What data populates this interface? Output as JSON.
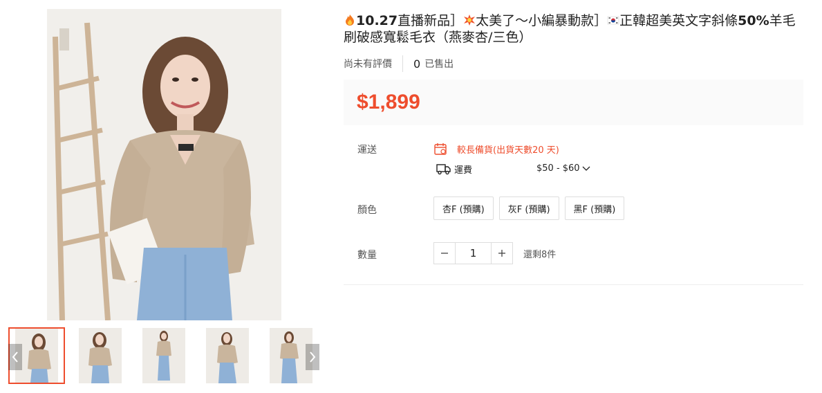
{
  "product": {
    "title_parts": [
      "10.27",
      "直播新品］",
      "太美了～小編暴動款］",
      "正韓超美英文字斜條",
      "50%",
      "羊毛刷破感寬鬆毛衣（燕麥杏/三色）"
    ],
    "icons": {
      "title_fire": "fire-emoji-icon",
      "title_burst": "collision-emoji-icon",
      "title_flag": "korea-flag-icon",
      "prev": "chevron-left-icon",
      "next": "chevron-right-icon",
      "shipping_date": "calendar-icon",
      "shipping_fee": "truck-icon",
      "fee_dropdown": "chevron-down-icon",
      "minus": "minus-icon",
      "plus": "plus-icon"
    },
    "rating_text": "尚未有評價",
    "sold_count": "0",
    "sold_label": "已售出",
    "price": "$1,899",
    "accent_color": "#ee4d2d"
  },
  "shipping": {
    "label": "運送",
    "lead_time": "較長備貨(出貨天數20 天)",
    "fee_label": "運費",
    "fee_range": "$50 - $60"
  },
  "color": {
    "label": "顏色",
    "options": [
      "杏F (預購)",
      "灰F (預購)",
      "黑F (預購)"
    ]
  },
  "quantity": {
    "label": "數量",
    "value": "1",
    "stock_text": "還剩8件"
  },
  "gallery": {
    "thumbnail_count": 5,
    "selected_index": 0
  }
}
